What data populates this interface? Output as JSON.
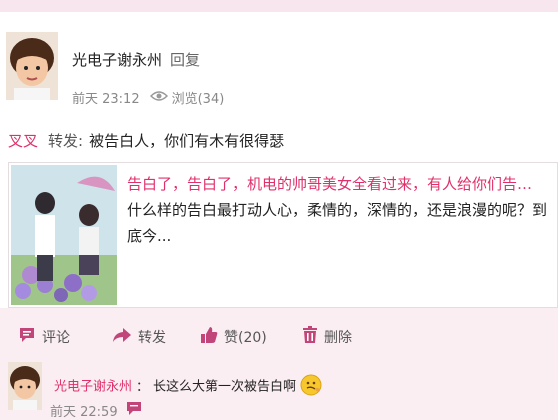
{
  "post": {
    "author": "光电子谢永州",
    "reply_label": "回复",
    "time": "前天 23:12",
    "views_label": "浏览(34)",
    "forward_user": "叉叉",
    "forward_label": "转发:",
    "forward_text": "被告白人，你们有木有很得瑟",
    "quote_headline": "告白了，告白了，机电的帅哥美女全看过来，有人给你们告…",
    "quote_body": "什么样的告白最打动人心，柔情的，深情的，还是浪漫的呢？到底今..."
  },
  "actions": {
    "comment": "评论",
    "forward": "转发",
    "like": "赞(20)",
    "delete": "删除"
  },
  "comment": {
    "author": "光电子谢永州",
    "separator": "：",
    "text": "长这么大第一次被告白啊",
    "time": "前天 22:59"
  },
  "colors": {
    "accent": "#e0306a",
    "background": "#fbeef3",
    "icon": "#c2457a"
  },
  "icons": [
    "eye-icon",
    "comment-icon",
    "forward-icon",
    "like-icon",
    "delete-icon",
    "emoji-icon",
    "message-icon"
  ]
}
